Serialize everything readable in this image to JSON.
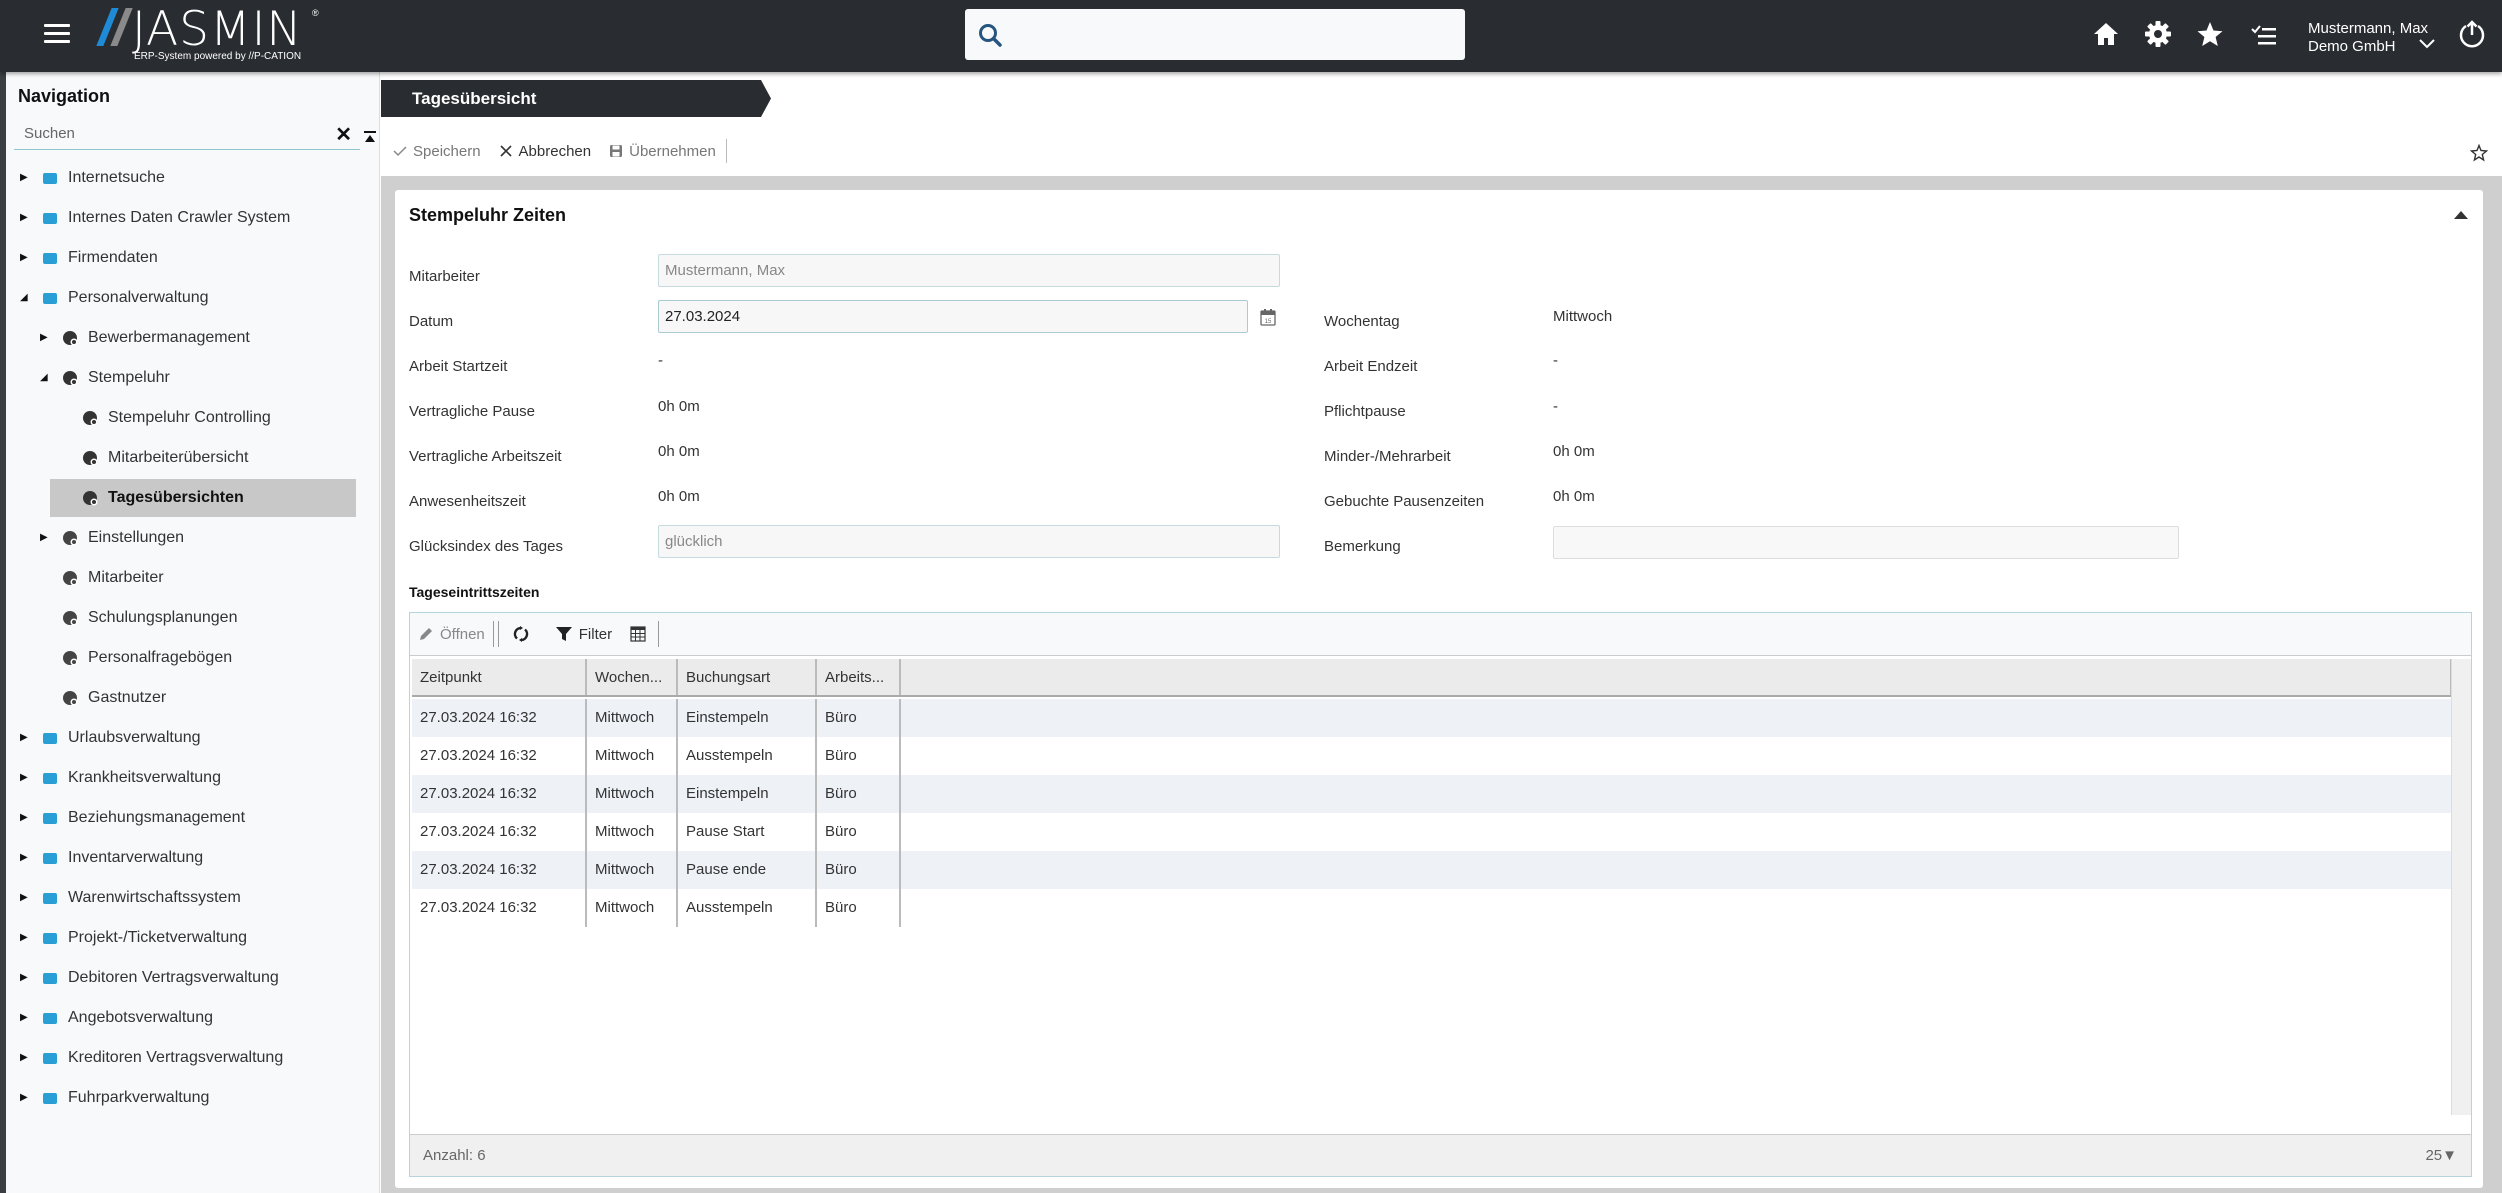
{
  "header": {
    "brand": "JASMIN",
    "registered": "®",
    "tagline": "ERP-System powered by //P-CATION",
    "search_placeholder": "",
    "user_name": "Mustermann, Max",
    "company": "Demo GmbH",
    "icons": [
      "menu-icon",
      "search-icon",
      "home-icon",
      "gear-icon",
      "star-icon",
      "checklist-icon",
      "chevron-down-icon",
      "power-icon"
    ]
  },
  "sidebar": {
    "title": "Navigation",
    "search_placeholder": "Suchen",
    "items": [
      {
        "label": "Internetsuche",
        "level": 0,
        "expander": "collapsed",
        "icon": "cloud-search-icon"
      },
      {
        "label": "Internes Daten Crawler System",
        "level": 0,
        "expander": "collapsed",
        "icon": "swap-arrows-icon"
      },
      {
        "label": "Firmendaten",
        "level": 0,
        "expander": "collapsed",
        "icon": "building-icon"
      },
      {
        "label": "Personalverwaltung",
        "level": 0,
        "expander": "expanded",
        "icon": "people-icon"
      },
      {
        "label": "Bewerbermanagement",
        "level": 1,
        "expander": "collapsed",
        "icon": "applicant-icon"
      },
      {
        "label": "Stempeluhr",
        "level": 1,
        "expander": "expanded",
        "icon": "time-clock-icon"
      },
      {
        "label": "Stempeluhr Controlling",
        "level": 2,
        "expander": "none",
        "icon": "time-clock-gear-icon"
      },
      {
        "label": "Mitarbeiterübersicht",
        "level": 2,
        "expander": "none",
        "icon": "time-clock-user-icon"
      },
      {
        "label": "Tagesübersichten",
        "level": 2,
        "expander": "none",
        "icon": "time-clock-day-icon",
        "active": true
      },
      {
        "label": "Einstellungen",
        "level": 1,
        "expander": "collapsed",
        "icon": "gears-icon"
      },
      {
        "label": "Mitarbeiter",
        "level": 1,
        "expander": "none",
        "icon": "person-icon"
      },
      {
        "label": "Schulungsplanungen",
        "level": 1,
        "expander": "none",
        "icon": "training-icon"
      },
      {
        "label": "Personalfragebögen",
        "level": 1,
        "expander": "none",
        "icon": "questionnaire-icon"
      },
      {
        "label": "Gastnutzer",
        "level": 1,
        "expander": "none",
        "icon": "guest-user-icon"
      },
      {
        "label": "Urlaubsverwaltung",
        "level": 0,
        "expander": "collapsed",
        "icon": "palm-tree-icon"
      },
      {
        "label": "Krankheitsverwaltung",
        "level": 0,
        "expander": "collapsed",
        "icon": "medical-kit-icon"
      },
      {
        "label": "Beziehungsmanagement",
        "level": 0,
        "expander": "collapsed",
        "icon": "group-icon"
      },
      {
        "label": "Inventarverwaltung",
        "level": 0,
        "expander": "collapsed",
        "icon": "factory-icon"
      },
      {
        "label": "Warenwirtschaftssystem",
        "level": 0,
        "expander": "collapsed",
        "icon": "cart-icon"
      },
      {
        "label": "Projekt-/Ticketverwaltung",
        "level": 0,
        "expander": "collapsed",
        "icon": "project-icon"
      },
      {
        "label": "Debitoren Vertragsverwaltung",
        "level": 0,
        "expander": "collapsed",
        "icon": "user-contract-icon"
      },
      {
        "label": "Angebotsverwaltung",
        "level": 0,
        "expander": "collapsed",
        "icon": "offer-document-icon"
      },
      {
        "label": "Kreditoren Vertragsverwaltung",
        "level": 0,
        "expander": "collapsed",
        "icon": "house-contract-icon"
      },
      {
        "label": "Fuhrparkverwaltung",
        "level": 0,
        "expander": "collapsed",
        "icon": "car-icon"
      }
    ]
  },
  "tab": {
    "label": "Tagesübersicht"
  },
  "toolbar": {
    "save_label": "Speichern",
    "cancel_label": "Abbrechen",
    "apply_label": "Übernehmen"
  },
  "panel": {
    "title": "Stempeluhr Zeiten",
    "fields": {
      "mitarbeiter_label": "Mitarbeiter",
      "mitarbeiter_value": "Mustermann, Max",
      "datum_label": "Datum",
      "datum_value": "27.03.2024",
      "wochentag_label": "Wochentag",
      "wochentag_value": "Mittwoch",
      "arbeit_start_label": "Arbeit Startzeit",
      "arbeit_start_value": "-",
      "arbeit_ende_label": "Arbeit Endzeit",
      "arbeit_ende_value": "-",
      "vertr_pause_label": "Vertragliche Pause",
      "vertr_pause_value": "0h 0m",
      "pflichtpause_label": "Pflichtpause",
      "pflichtpause_value": "-",
      "vertr_arbeitszeit_label": "Vertragliche Arbeitszeit",
      "vertr_arbeitszeit_value": "0h 0m",
      "minder_mehr_label": "Minder-/Mehrarbeit",
      "minder_mehr_value": "0h 0m",
      "anwesenheit_label": "Anwesenheitszeit",
      "anwesenheit_value": "0h 0m",
      "gebuchte_pausen_label": "Gebuchte Pausenzeiten",
      "gebuchte_pausen_value": "0h 0m",
      "gluecksindex_label": "Glücksindex des Tages",
      "gluecksindex_value": "glücklich",
      "bemerkung_label": "Bemerkung",
      "bemerkung_value": ""
    }
  },
  "grid": {
    "title": "Tageseintrittszeiten",
    "toolbar": {
      "open_label": "Öffnen",
      "filter_label": "Filter"
    },
    "columns": [
      "Zeitpunkt",
      "Wochen...",
      "Buchungsart",
      "Arbeits..."
    ],
    "rows": [
      [
        "27.03.2024 16:32",
        "Mittwoch",
        "Einstempeln",
        "Büro"
      ],
      [
        "27.03.2024 16:32",
        "Mittwoch",
        "Ausstempeln",
        "Büro"
      ],
      [
        "27.03.2024 16:32",
        "Mittwoch",
        "Einstempeln",
        "Büro"
      ],
      [
        "27.03.2024 16:32",
        "Mittwoch",
        "Pause Start",
        "Büro"
      ],
      [
        "27.03.2024 16:32",
        "Mittwoch",
        "Pause ende",
        "Büro"
      ],
      [
        "27.03.2024 16:32",
        "Mittwoch",
        "Ausstempeln",
        "Büro"
      ]
    ],
    "count_label": "Anzahl: 6",
    "page_size": "25"
  },
  "colors": {
    "topbar": "#292c30",
    "accent_blue": "#1f8bd6",
    "nav_icon_blue": "#2a9fd6",
    "active_item_bg": "#c8c8c8",
    "row_alt": "#eef2f7"
  }
}
